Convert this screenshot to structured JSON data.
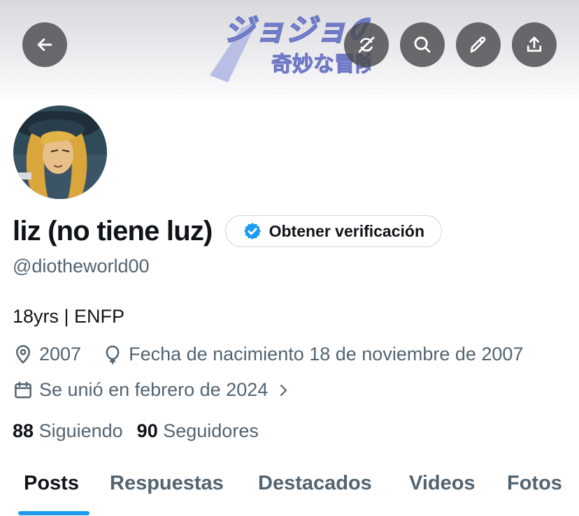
{
  "banner": {
    "logo_line1": "ジョジョの",
    "logo_line2": "奇妙な冒険"
  },
  "header_buttons": [
    {
      "icon": "back-arrow-icon"
    },
    {
      "icon": "no-sync-icon"
    },
    {
      "icon": "search-icon"
    },
    {
      "icon": "pencil-icon"
    },
    {
      "icon": "share-icon"
    }
  ],
  "profile": {
    "display_name": "liz (no tiene luz)",
    "verify_label": "Obtener verificación",
    "handle": "@diotheworld00",
    "bio": "18yrs | ENFP",
    "location": "2007",
    "birthday": "Fecha de nacimiento 18 de noviembre de 2007",
    "joined": "Se unió en febrero de 2024",
    "following_count": "88",
    "following_label": "Siguiendo",
    "followers_count": "90",
    "followers_label": "Seguidores"
  },
  "tabs": {
    "posts": "Posts",
    "replies": "Respuestas",
    "highlights": "Destacados",
    "videos": "Videos",
    "photos": "Fotos",
    "active": "posts"
  },
  "colors": {
    "accent": "#1d9bf0",
    "text_primary": "#0f1419",
    "text_secondary": "#536471",
    "button_overlay": "#4b4b4e"
  }
}
